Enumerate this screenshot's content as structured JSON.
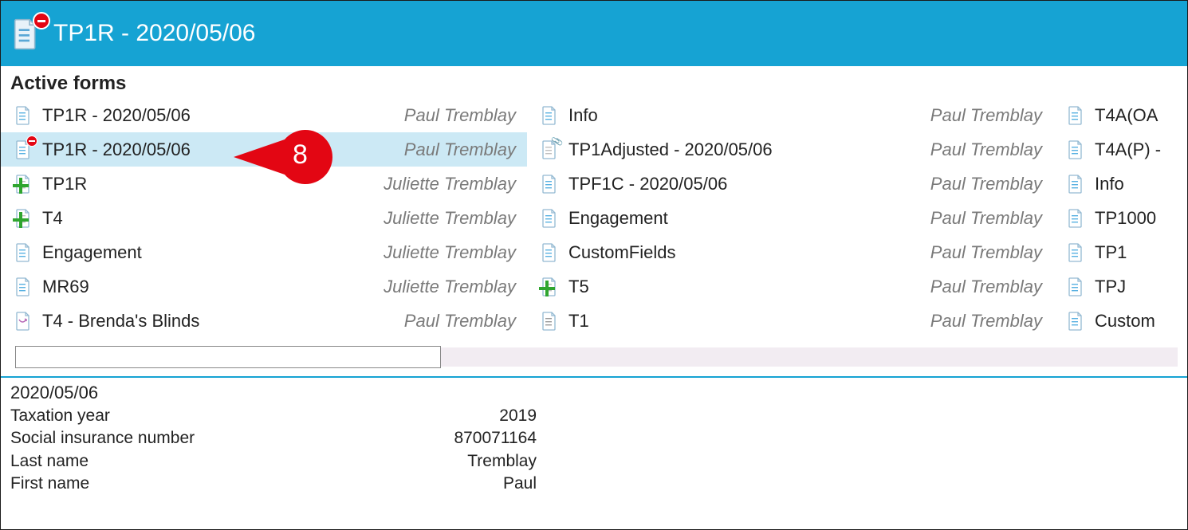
{
  "header": {
    "title": "TP1R - 2020/05/06",
    "icon": "document-minus-icon"
  },
  "section_heading": "Active forms",
  "callout": {
    "label": "8"
  },
  "columns": [
    [
      {
        "icon": "doc-blue",
        "name": "TP1R - 2020/05/06",
        "owner": "Paul Tremblay",
        "selected": false
      },
      {
        "icon": "doc-minus",
        "name": "TP1R - 2020/05/06",
        "owner": "Paul Tremblay",
        "selected": true
      },
      {
        "icon": "doc-plus",
        "name": "TP1R",
        "owner": "Juliette Tremblay",
        "selected": false
      },
      {
        "icon": "doc-plus",
        "name": "T4",
        "owner": "Juliette Tremblay",
        "selected": false
      },
      {
        "icon": "doc-blue",
        "name": "Engagement",
        "owner": "Juliette Tremblay",
        "selected": false
      },
      {
        "icon": "doc-blue",
        "name": "MR69",
        "owner": "Juliette Tremblay",
        "selected": false
      },
      {
        "icon": "doc-arrow",
        "name": "T4 - Brenda's Blinds",
        "owner": "Paul Tremblay",
        "selected": false
      }
    ],
    [
      {
        "icon": "doc-blue",
        "name": "Info",
        "owner": "Paul Tremblay",
        "selected": false
      },
      {
        "icon": "doc-clip",
        "name": "TP1Adjusted - 2020/05/06",
        "owner": "Paul Tremblay",
        "selected": false
      },
      {
        "icon": "doc-blue",
        "name": "TPF1C - 2020/05/06",
        "owner": "Paul Tremblay",
        "selected": false
      },
      {
        "icon": "doc-blue",
        "name": "Engagement",
        "owner": "Paul Tremblay",
        "selected": false
      },
      {
        "icon": "doc-blue",
        "name": "CustomFields",
        "owner": "Paul Tremblay",
        "selected": false
      },
      {
        "icon": "doc-plus",
        "name": "T5",
        "owner": "Paul Tremblay",
        "selected": false
      },
      {
        "icon": "doc-gray",
        "name": "T1",
        "owner": "Paul Tremblay",
        "selected": false
      }
    ],
    [
      {
        "icon": "doc-blue",
        "name": "T4A(OA",
        "owner": "",
        "selected": false
      },
      {
        "icon": "doc-blue",
        "name": "T4A(P) -",
        "owner": "",
        "selected": false
      },
      {
        "icon": "doc-blue",
        "name": "Info",
        "owner": "",
        "selected": false
      },
      {
        "icon": "doc-blue",
        "name": "TP1000",
        "owner": "",
        "selected": false
      },
      {
        "icon": "doc-blue",
        "name": "TP1",
        "owner": "",
        "selected": false
      },
      {
        "icon": "doc-blue",
        "name": "TPJ",
        "owner": "",
        "selected": false
      },
      {
        "icon": "doc-blue",
        "name": "Custom",
        "owner": "",
        "selected": false
      }
    ]
  ],
  "filter": {
    "value": ""
  },
  "details": {
    "date": "2020/05/06",
    "rows": [
      {
        "label": "Taxation year",
        "value": "2019"
      },
      {
        "label": "Social insurance number",
        "value": "870071164"
      },
      {
        "label": "Last name",
        "value": "Tremblay"
      },
      {
        "label": "First name",
        "value": "Paul"
      }
    ]
  }
}
